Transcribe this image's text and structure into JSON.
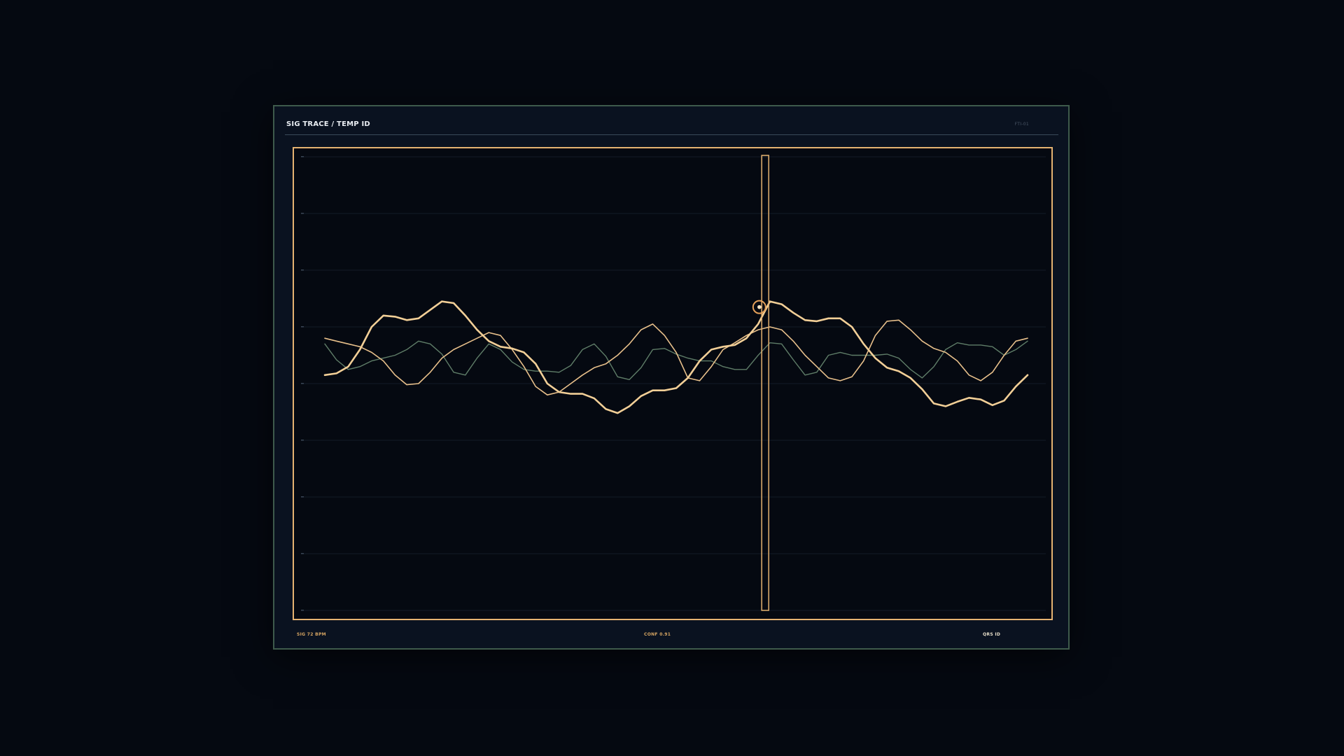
{
  "header": {
    "title": "SIG TRACE / TEMP ID",
    "code": "FTI-01"
  },
  "footer": {
    "left": "SIG 72 BPM",
    "mid": "CONF 0.91",
    "right": "QRS ID"
  },
  "colors": {
    "background": "#050911",
    "panel": "#0a1220",
    "panel_border": "#3e5a4b",
    "frame": "#e5b271",
    "trace_primary": "#f2cf97",
    "trace_secondary": "#e8c08b",
    "trace_tertiary": "#5f7d68",
    "marker": "#e6a15a",
    "grid": "#121a26"
  },
  "chart_data": {
    "type": "line",
    "title": "SIG TRACE / TEMP ID",
    "xlabel": "",
    "ylabel": "",
    "grid": true,
    "xlim": [
      0,
      60
    ],
    "ylim": [
      0,
      8
    ],
    "ytick_values": [
      0,
      1,
      2,
      3,
      4,
      5,
      6,
      7,
      8
    ],
    "x": [
      0,
      1,
      2,
      3,
      4,
      5,
      6,
      7,
      8,
      9,
      10,
      11,
      12,
      13,
      14,
      15,
      16,
      17,
      18,
      19,
      20,
      21,
      22,
      23,
      24,
      25,
      26,
      27,
      28,
      29,
      30,
      31,
      32,
      33,
      34,
      35,
      36,
      37,
      38,
      39,
      40,
      41,
      42,
      43,
      44,
      45,
      46,
      47,
      48,
      49,
      50,
      51,
      52,
      53,
      54,
      55,
      56,
      57,
      58,
      59,
      60
    ],
    "series": [
      {
        "values": [
          4.15,
          4.18,
          4.3,
          4.6,
          5.0,
          5.2,
          5.18,
          5.12,
          5.15,
          5.3,
          5.45,
          5.42,
          5.2,
          4.95,
          4.75,
          4.65,
          4.62,
          4.55,
          4.35,
          4.0,
          3.85,
          3.82,
          3.82,
          3.74,
          3.55,
          3.48,
          3.6,
          3.78,
          3.88,
          3.88,
          3.92,
          4.1,
          4.4,
          4.6,
          4.65,
          4.68,
          4.8,
          5.05,
          5.45,
          5.4,
          5.25,
          5.12,
          5.1,
          5.15,
          5.15,
          5.0,
          4.7,
          4.45,
          4.28,
          4.22,
          4.1,
          3.9,
          3.65,
          3.6,
          3.68,
          3.75,
          3.72,
          3.62,
          3.7,
          3.95,
          4.15
        ]
      },
      {
        "values": [
          4.8,
          4.75,
          4.7,
          4.65,
          4.55,
          4.4,
          4.15,
          3.98,
          4.0,
          4.2,
          4.45,
          4.6,
          4.7,
          4.8,
          4.9,
          4.85,
          4.6,
          4.3,
          3.95,
          3.8,
          3.85,
          4.0,
          4.15,
          4.28,
          4.35,
          4.5,
          4.7,
          4.95,
          5.05,
          4.85,
          4.55,
          4.1,
          4.05,
          4.3,
          4.6,
          4.72,
          4.85,
          4.95,
          5.0,
          4.95,
          4.75,
          4.5,
          4.3,
          4.1,
          4.05,
          4.12,
          4.4,
          4.85,
          5.1,
          5.12,
          4.95,
          4.75,
          4.62,
          4.55,
          4.4,
          4.15,
          4.05,
          4.2,
          4.5,
          4.75,
          4.8
        ]
      },
      {
        "values": [
          4.7,
          4.42,
          4.25,
          4.3,
          4.4,
          4.45,
          4.5,
          4.6,
          4.75,
          4.7,
          4.52,
          4.2,
          4.15,
          4.45,
          4.7,
          4.6,
          4.38,
          4.25,
          4.22,
          4.22,
          4.2,
          4.32,
          4.6,
          4.7,
          4.48,
          4.12,
          4.07,
          4.28,
          4.6,
          4.62,
          4.52,
          4.45,
          4.4,
          4.4,
          4.3,
          4.25,
          4.25,
          4.5,
          4.72,
          4.7,
          4.42,
          4.15,
          4.2,
          4.5,
          4.55,
          4.5,
          4.5,
          4.5,
          4.52,
          4.45,
          4.25,
          4.1,
          4.3,
          4.6,
          4.72,
          4.68,
          4.68,
          4.65,
          4.5,
          4.6,
          4.75
        ]
      }
    ],
    "selection_x": 37.6,
    "marker_point": {
      "x": 37.1,
      "y": 5.35
    }
  }
}
